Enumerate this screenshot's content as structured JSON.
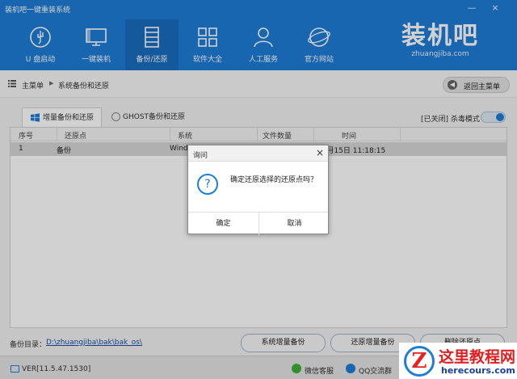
{
  "app": {
    "title": "装机吧一键重装系统"
  },
  "window": {
    "minimize": "—",
    "close": "×"
  },
  "nav": {
    "items": [
      {
        "label": "U 盘启动",
        "icon": "usb-icon"
      },
      {
        "label": "一键装机",
        "icon": "monitor-icon"
      },
      {
        "label": "备份/还原",
        "icon": "database-icon",
        "active": true
      },
      {
        "label": "软件大全",
        "icon": "grid-icon"
      },
      {
        "label": "人工服务",
        "icon": "person-icon"
      },
      {
        "label": "官方网站",
        "icon": "globe-icon"
      }
    ]
  },
  "brand": {
    "logo": "装机吧",
    "url": "zhuangjiba.com"
  },
  "breadcrumb": {
    "home": "主菜单",
    "sep": "▶",
    "current": "系统备份和还原",
    "back": "返回主菜单",
    "back_arrow": "◀"
  },
  "tabs": [
    {
      "label": "增量备份和还原",
      "icon": "windows-icon",
      "active": true
    },
    {
      "label": "GHOST备份和还原",
      "icon": "ghost-icon"
    }
  ],
  "antivirus": {
    "label": "[已关闭] 杀毒模式",
    "on": false
  },
  "table": {
    "headers": [
      "序号",
      "还原点",
      "系统",
      "文件数量",
      "时间"
    ],
    "rows": [
      {
        "index": "1",
        "name": "备份",
        "system": "Windo",
        "time": "05月15日 11:18:15"
      }
    ]
  },
  "backup_dir": {
    "label": "备份目录：",
    "path": "D:\\zhuangjiba\\bak\\bak_os\\"
  },
  "actions": {
    "incremental_backup": "系统增量备份",
    "restore": "还原增量备份",
    "delete": "删除还原点"
  },
  "status": {
    "version": "VER[11.5.47.1530]",
    "wechat": "微信客服",
    "qq": "QQ交流群"
  },
  "dialog": {
    "title": "询问",
    "close": "×",
    "icon": "?",
    "message": "确定还原选择的还原点吗？",
    "ok": "确定",
    "cancel": "取消"
  },
  "watermark": {
    "mark": "Z",
    "name": "这里教程网",
    "url": "herecours.com"
  },
  "colors": {
    "primary": "#1e7dd6",
    "watermark_red": "#e02020"
  }
}
